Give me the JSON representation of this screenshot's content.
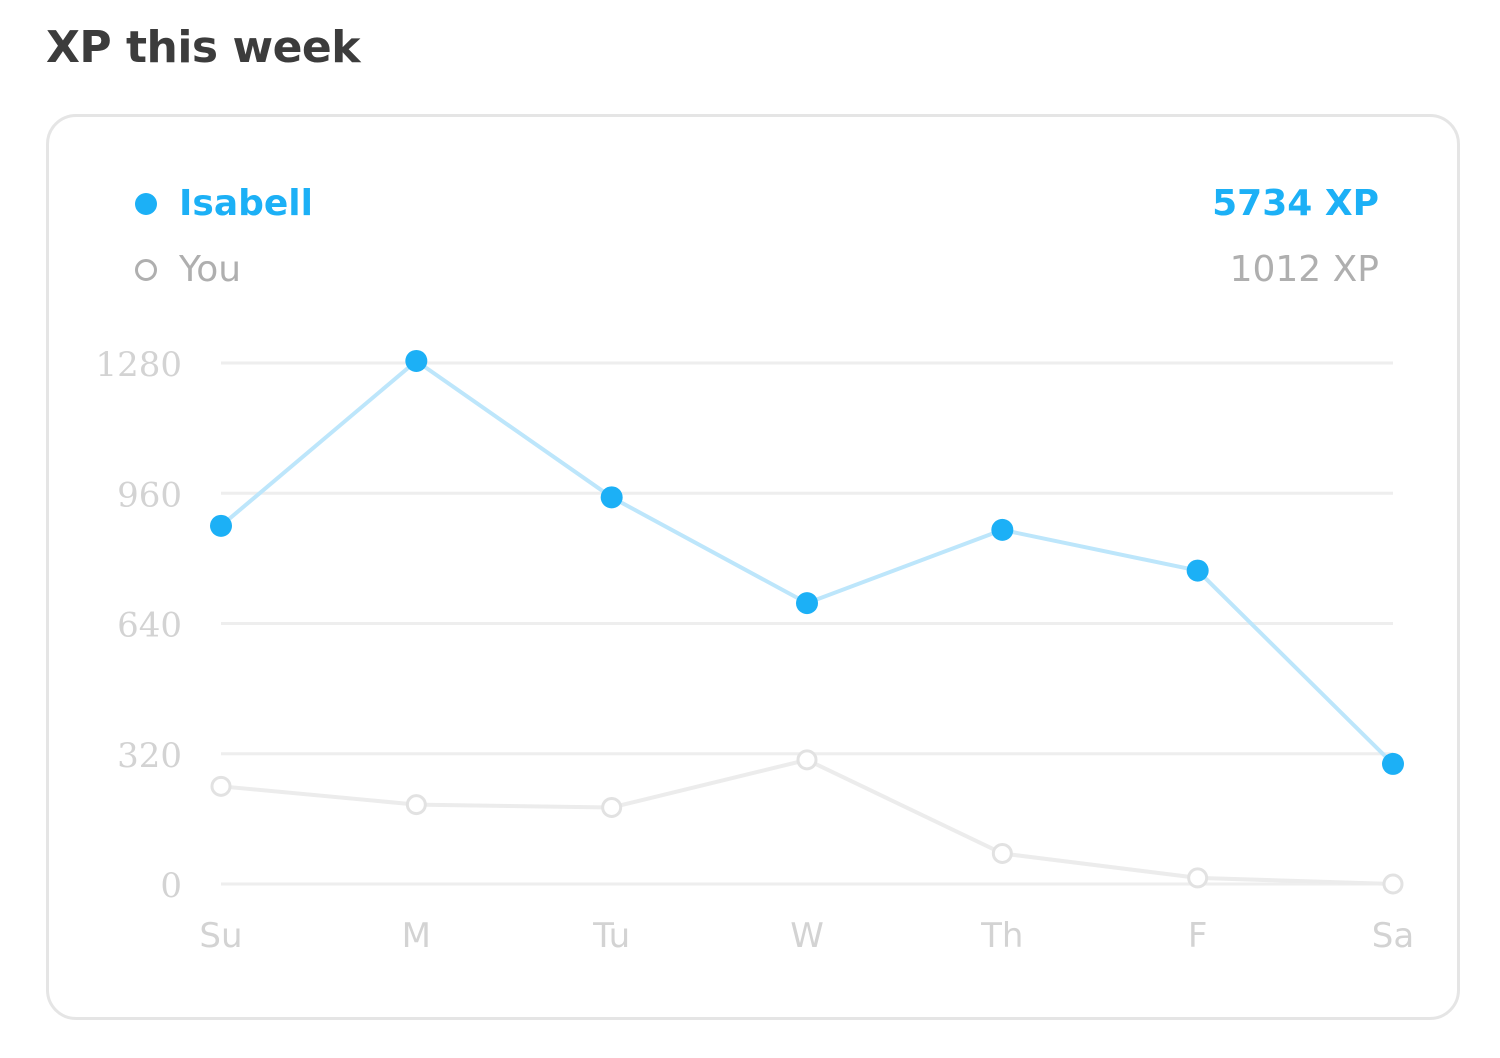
{
  "title": "XP this week",
  "legend": [
    {
      "name": "Isabell",
      "total": "5734 XP"
    },
    {
      "name": "You",
      "total": "1012 XP"
    }
  ],
  "colors": {
    "primary": "#1cb0f6",
    "primary_line": "#bde6fb",
    "secondary_marker": "#e2e2e2",
    "secondary_line": "#ececec",
    "grid": "#eeeeee",
    "tick_text": "#d3d3d3"
  },
  "chart_data": {
    "type": "line",
    "categories": [
      "Su",
      "M",
      "Tu",
      "W",
      "Th",
      "F",
      "Sa"
    ],
    "y_ticks": [
      "0",
      "320",
      "960",
      "640",
      "1280"
    ],
    "y_tick_values": [
      0,
      320,
      640,
      960,
      1280
    ],
    "ylim": [
      0,
      1280
    ],
    "grid": true,
    "legend_position": "top",
    "series": [
      {
        "name": "Isabell",
        "values": [
          880,
          1285,
          950,
          690,
          870,
          770,
          295
        ]
      },
      {
        "name": "You",
        "values": [
          240,
          195,
          188,
          305,
          75,
          15,
          0
        ]
      }
    ]
  }
}
